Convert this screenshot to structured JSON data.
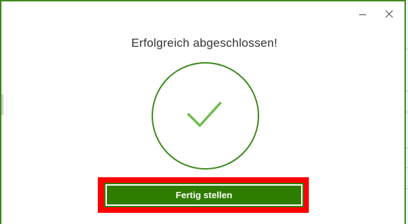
{
  "dialog": {
    "heading": "Erfolgreich abgeschlossen!",
    "icons": {
      "minimize": "minimize-icon",
      "close": "close-icon",
      "success": "checkmark-circle-icon"
    },
    "finish_button_label": "Fertig stellen"
  },
  "colors": {
    "accent": "#2f7d00",
    "circle": "#3a8a1a",
    "check": "#6cbf4a",
    "highlight": "#ff0000"
  }
}
